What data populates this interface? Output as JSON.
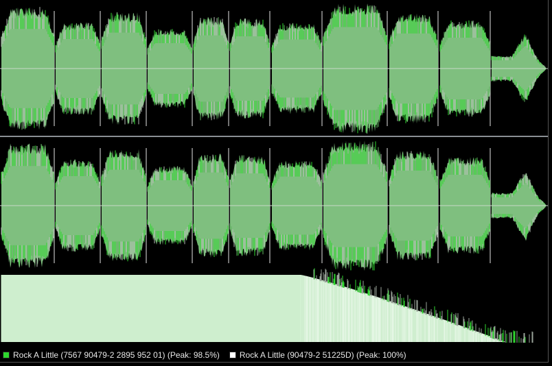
{
  "colors": {
    "background": "#000000",
    "track_a": "#2fd72f",
    "track_b": "#ffffff",
    "overlap_fill": "#7fbf7f",
    "spectrum_fill": "#d8f5d8",
    "center_line": "#c8d8c8",
    "divider": "#8a8f94"
  },
  "waveform": {
    "channels": 2,
    "segments": [
      {
        "level": 0.86
      },
      {
        "level": 0.64
      },
      {
        "level": 0.78
      },
      {
        "level": 0.55
      },
      {
        "level": 0.72
      },
      {
        "level": 0.7
      },
      {
        "level": 0.63
      },
      {
        "level": 0.9
      },
      {
        "level": 0.76
      },
      {
        "level": 0.67
      },
      {
        "level": 0.3
      }
    ]
  },
  "legend": {
    "items": [
      {
        "label": "Rock A Little (7567 90479-2 2895 952 01) (Peak: 98.5%)",
        "color": "#2fd72f"
      },
      {
        "label": "Rock A Little (90479-2 51225D) (Peak: 100%)",
        "color": "#ffffff"
      }
    ]
  }
}
